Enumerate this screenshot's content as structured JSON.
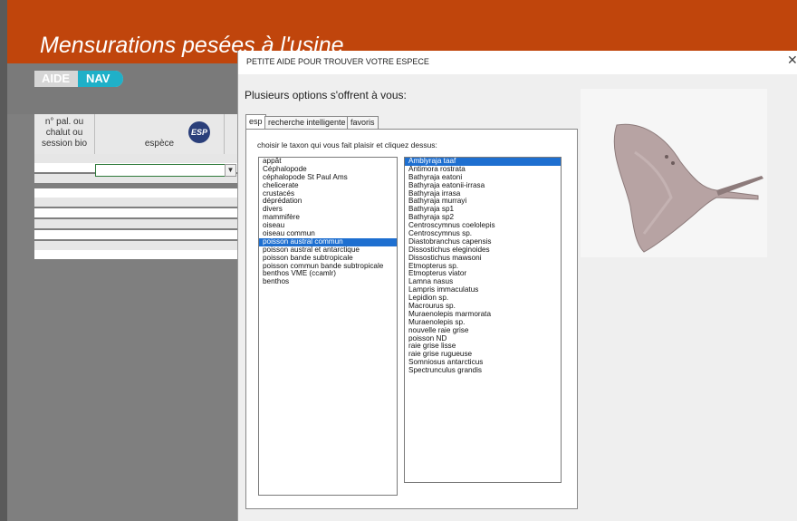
{
  "sheet": {
    "title": "Mensurations pesées à l'usine",
    "nav_pills": [
      "AIDE",
      "NAV"
    ],
    "headers": {
      "pal": "n° pal. ou chalut ou session bio",
      "espece": "espèce",
      "esp_button": "ESP"
    },
    "colors": {
      "banner": "#c0450c",
      "nav": "#1fb0c8"
    }
  },
  "dialog": {
    "title": "PETITE AIDE POUR TROUVER VOTRE ESPECE",
    "close_icon": "close-icon",
    "options_text": "Plusieurs options s'offrent à vous:",
    "tabs": [
      "esp",
      "recherche intelligente",
      "favoris"
    ],
    "instruction": "choisir le taxon qui vous fait plaisir et cliquez dessus:",
    "taxa": [
      "appât",
      "Céphalopode",
      "céphalopode St Paul Ams",
      "chelicerate",
      "crustacés",
      "déprédation",
      "divers",
      "mammifère",
      "oiseau",
      "oiseau commun",
      "poisson austral commun",
      "poisson austral et antarctique",
      "poisson bande subtropicale",
      "poisson commun bande subtropicale",
      "benthos VME (ccamlr)",
      "benthos"
    ],
    "selected_taxon": "poisson austral commun",
    "species": [
      "Amblyraja taaf",
      "Antimora rostrata",
      "Bathyraja eatoni",
      "Bathyraja eatonii-irrasa",
      "Bathyraja irrasa",
      "Bathyraja murrayi",
      "Bathyraja sp1",
      "Bathyraja sp2",
      "Centroscymnus coelolepis",
      "Centroscymnus sp.",
      "Diastobranchus capensis",
      "Dissostichus eleginoides",
      "Dissostichus mawsoni",
      "Etmopterus sp.",
      "Etmopterus viator",
      "Lamna nasus",
      "Lampris immaculatus",
      "Lepidion sp.",
      "Macrourus sp.",
      "Muraenolepis marmorata",
      "Muraenolepis sp.",
      "nouvelle raie grise",
      "poisson ND",
      "raie grise lisse",
      "raie grise rugueuse",
      "Somniosus antarcticus",
      "Spectrunculus grandis"
    ],
    "selected_species": "Amblyraja taaf"
  }
}
